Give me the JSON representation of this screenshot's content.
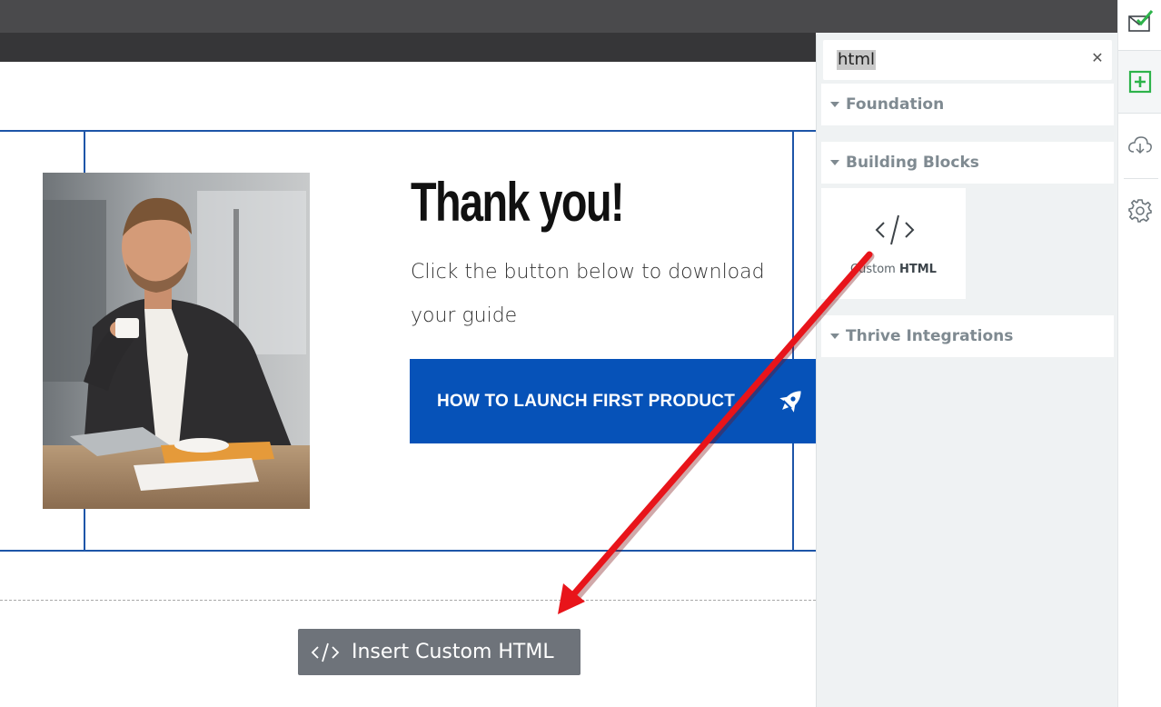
{
  "canvas": {
    "heading": "Thank you!",
    "body": "Click the button below to download your guide",
    "cta": {
      "label": "HOW TO LAUNCH FIRST PRODUCT",
      "icon": "rocket-icon",
      "color": "#0652b8"
    },
    "insert_button": {
      "label": "Insert Custom HTML",
      "icon": "code-icon"
    }
  },
  "panel": {
    "search": {
      "value": "html",
      "clear_icon": "close-icon"
    },
    "sections": [
      {
        "title": "Foundation"
      },
      {
        "title": "Building Blocks"
      },
      {
        "title": "Thrive Integrations"
      }
    ],
    "tile": {
      "label_prefix": "Custom",
      "label_bold": "HTML",
      "icon": "code-icon"
    }
  },
  "rail": {
    "items": [
      {
        "icon": "envelope-check-icon"
      },
      {
        "icon": "add-element-icon",
        "active": true
      },
      {
        "icon": "cloud-download-icon"
      },
      {
        "icon": "gear-icon"
      }
    ],
    "accent": "#2db34a"
  },
  "annotation": {
    "arrow_color": "#e8141a"
  }
}
